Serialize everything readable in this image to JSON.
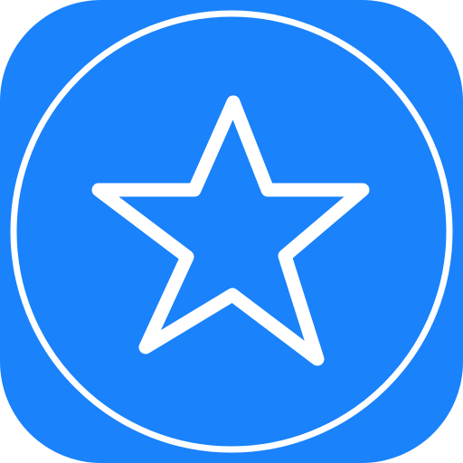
{
  "icon": {
    "name": "star-app-icon",
    "background_color": "#1A82FB",
    "foreground_color": "#FFFFFF",
    "shape": "rounded-square",
    "glyph": "star-outline-in-circle"
  }
}
